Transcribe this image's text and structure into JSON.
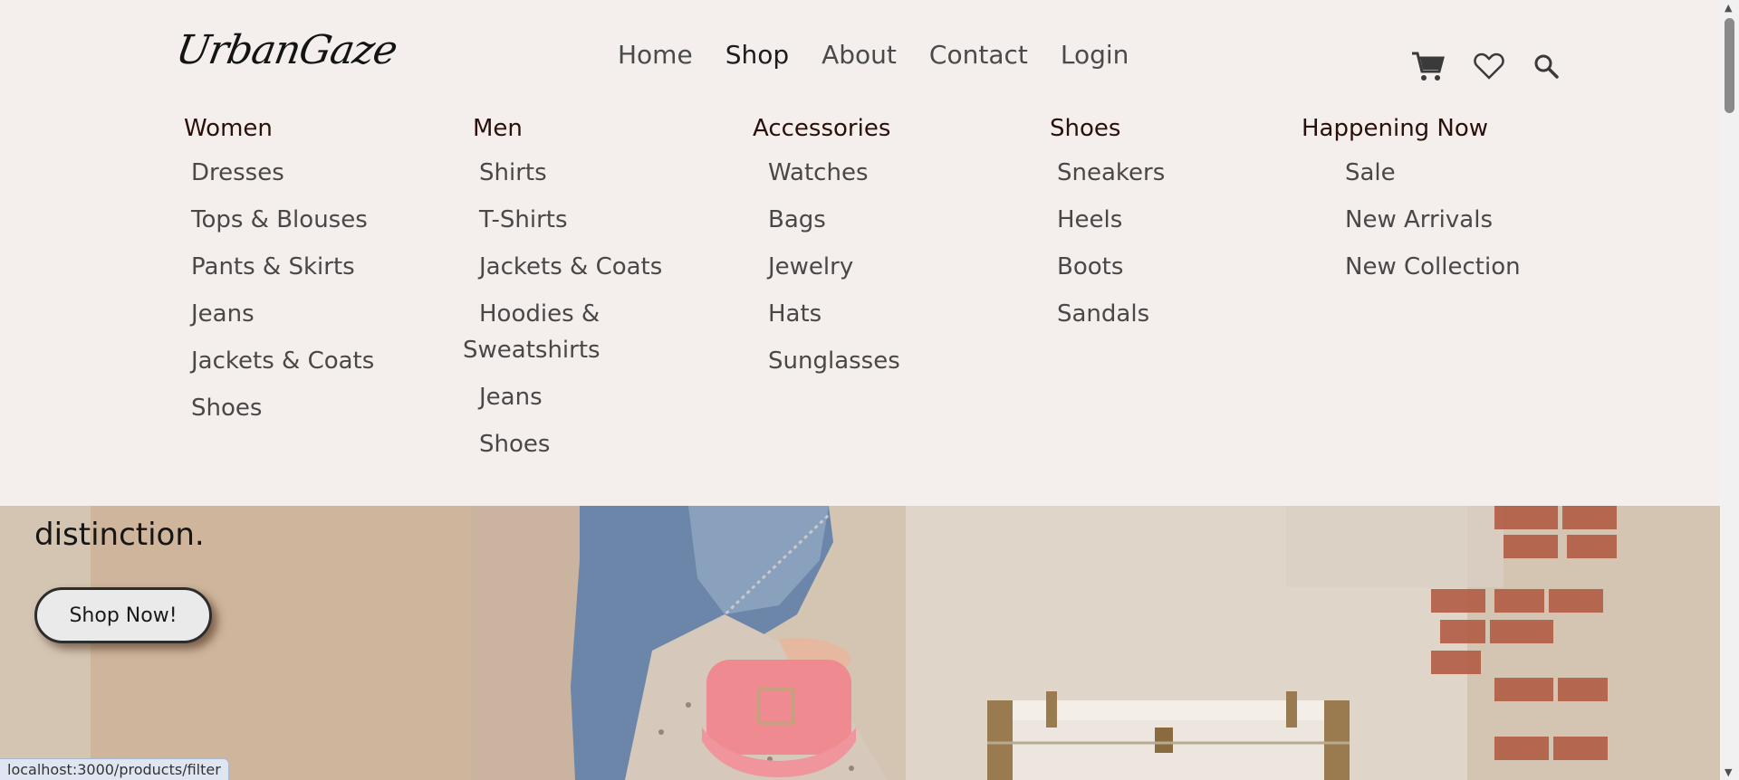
{
  "brand": {
    "logo_text": "UrbanGaze"
  },
  "nav": {
    "items": [
      {
        "label": "Home"
      },
      {
        "label": "Shop"
      },
      {
        "label": "About"
      },
      {
        "label": "Contact"
      },
      {
        "label": "Login"
      }
    ],
    "active": "Shop"
  },
  "header_icons": [
    "cart-icon",
    "heart-icon",
    "search-icon"
  ],
  "mega_menu": {
    "women": {
      "title": "Women",
      "items": [
        "Dresses",
        "Tops & Blouses",
        "Pants & Skirts",
        "Jeans",
        "Jackets & Coats",
        "Shoes"
      ]
    },
    "men": {
      "title": "Men",
      "items": [
        "Shirts",
        "T-Shirts",
        "Jackets & Coats",
        "Hoodies & Sweatshirts",
        "Jeans",
        "Shoes"
      ]
    },
    "accessories": {
      "title": "Accessories",
      "items": [
        "Watches",
        "Bags",
        "Jewelry",
        "Hats",
        "Sunglasses"
      ]
    },
    "shoes": {
      "title": "Shoes",
      "items": [
        "Sneakers",
        "Heels",
        "Boots",
        "Sandals"
      ]
    },
    "happening": {
      "title": "Happening Now",
      "items": [
        "Sale",
        "New Arrivals",
        "New Collection"
      ]
    }
  },
  "hero": {
    "heading": "distinction.",
    "cta": "Shop Now!"
  },
  "status_bar": {
    "url": "localhost:3000/products/filter"
  },
  "colors": {
    "background": "#f4efed",
    "menu_heading": "#2a0f0a",
    "menu_item": "#4b4747"
  }
}
